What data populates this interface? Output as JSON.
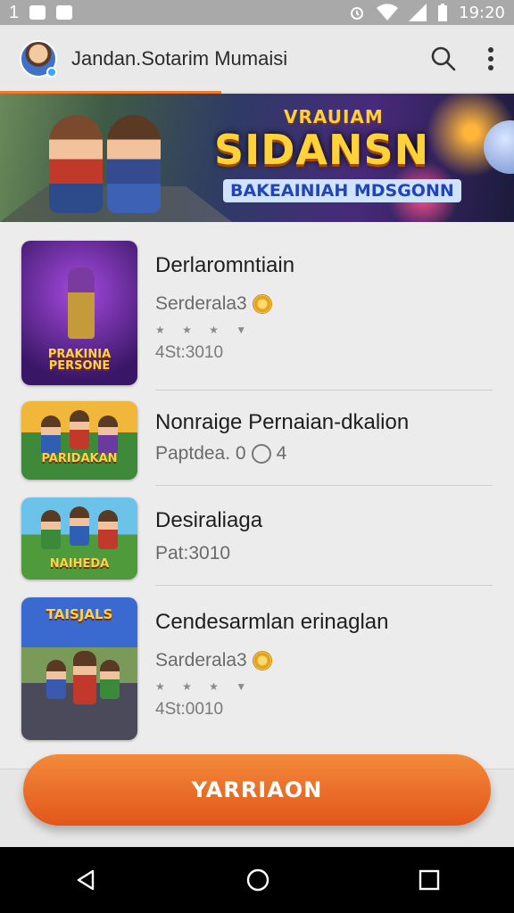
{
  "status_bar": {
    "left_text": "1",
    "time": "19:20"
  },
  "app_bar": {
    "title": "Jandan.Sotarim Mumaisi"
  },
  "banner": {
    "subtitle": "VRAUIAM",
    "title": "SIDANSN",
    "tagline": "BAKEAINIAH MDSGONN"
  },
  "games": [
    {
      "title": "Derlaromntiain",
      "subtitle": "Serderala3",
      "meta": "4St:3010",
      "thumb_caption": "PRAKINIA PERSONE"
    },
    {
      "title": "Nonraige Pernaian-dkalion",
      "subtitle": "Paptdea. 0",
      "subtitle_extra": "4",
      "thumb_caption": "PARIDAKAN"
    },
    {
      "title": "Desiraliaga",
      "subtitle": "Pat:3010",
      "thumb_caption": "NAIHEDA"
    },
    {
      "title": "Cendesarmlan erinaglan",
      "subtitle": "Sarderala3",
      "meta": "4St:0010",
      "thumb_caption": "TAISJALS"
    }
  ],
  "cta": {
    "label": "YARRIAON"
  },
  "colors": {
    "accent": "#f07a2a",
    "cta": "#e2561a",
    "title": "#ffd23a"
  },
  "icons": [
    "search-icon",
    "more-icon",
    "back-icon",
    "home-icon",
    "recents-icon"
  ]
}
